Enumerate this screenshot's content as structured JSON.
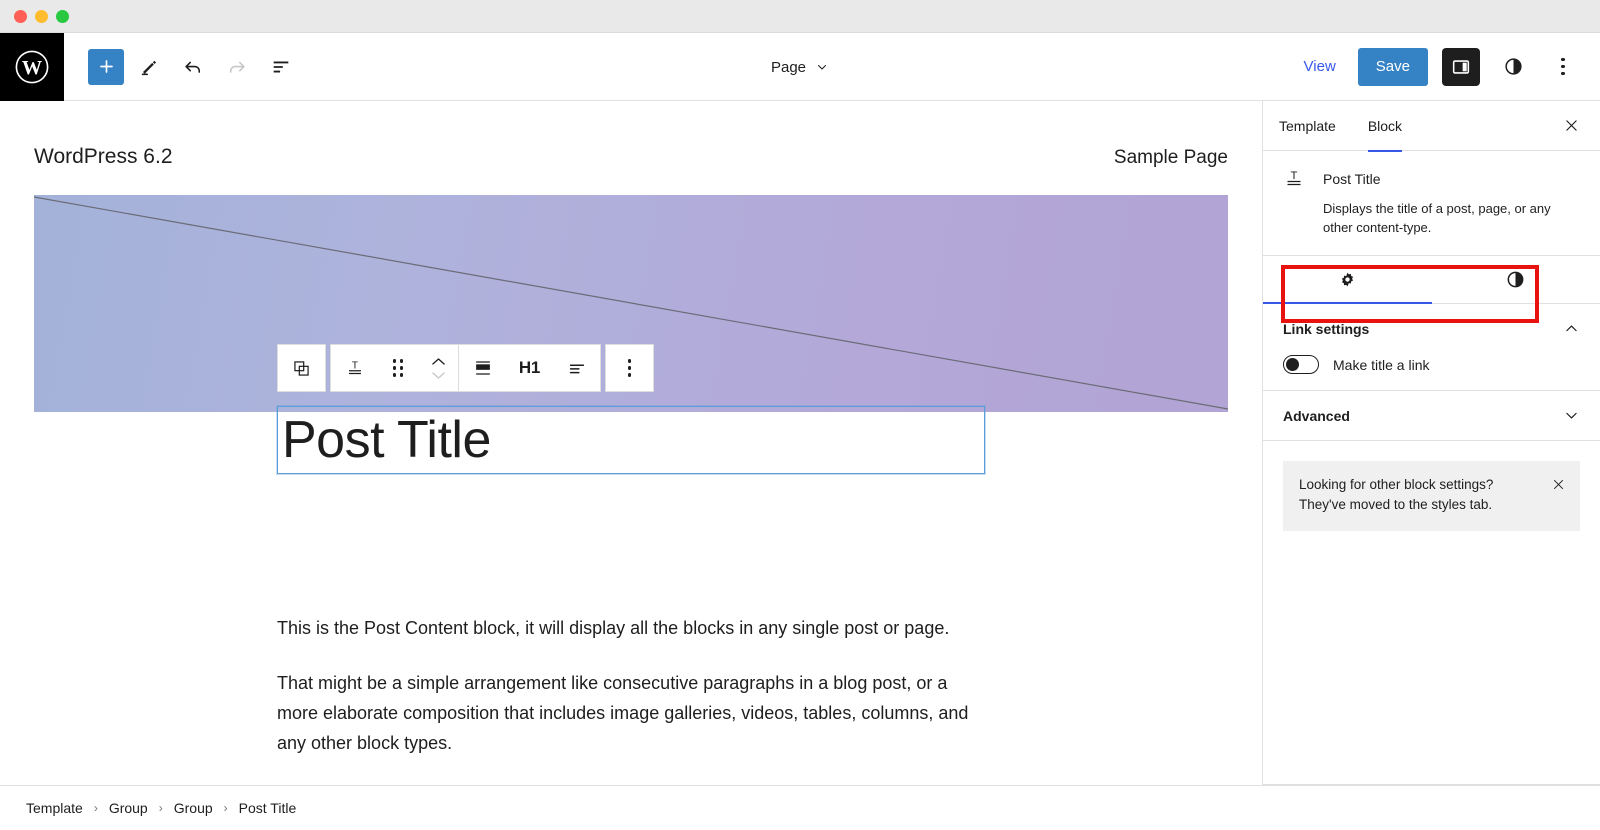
{
  "window": {
    "traffic_lights": [
      "close",
      "minimize",
      "maximize"
    ]
  },
  "topbar": {
    "logo_name": "wordpress-logo",
    "tools": [
      {
        "name": "add-block-button",
        "icon": "plus-icon",
        "label": "Add block"
      },
      {
        "name": "edit-tool-button",
        "icon": "pencil-icon",
        "label": "Edit"
      },
      {
        "name": "undo-button",
        "icon": "undo-arrow-icon",
        "label": "Undo"
      },
      {
        "name": "redo-button",
        "icon": "redo-arrow-icon",
        "label": "Redo"
      },
      {
        "name": "list-view-button",
        "icon": "list-view-icon",
        "label": "Document Overview"
      }
    ],
    "document_type": "Page",
    "document_chevron": "chevron-down-icon",
    "view_label": "View",
    "save_label": "Save",
    "settings_toggle_label": "Settings",
    "styles_toggle_label": "Styles",
    "options_label": "Options"
  },
  "canvas": {
    "site_title": "WordPress 6.2",
    "site_nav_item": "Sample Page",
    "cover": {
      "gradient_from": "#a3b2d9",
      "gradient_to": "#b2a4d4"
    },
    "block_toolbar": {
      "items": [
        {
          "name": "select-parent-block-button",
          "icon": "parent-block-icon"
        },
        {
          "name": "block-type-button",
          "icon": "post-title-icon"
        },
        {
          "name": "drag-handle",
          "icon": "drag-dots-icon"
        },
        {
          "name": "move-up-down-buttons",
          "icon": "chevron-up-down-icon"
        },
        {
          "name": "align-button",
          "icon": "align-icon"
        },
        {
          "name": "heading-level-button",
          "label": "H1"
        },
        {
          "name": "text-align-button",
          "icon": "text-align-icon"
        },
        {
          "name": "block-options-button",
          "icon": "kebab-icon"
        }
      ],
      "heading_level": "H1"
    },
    "post_title": "Post Title",
    "paragraphs": [
      "This is the Post Content block, it will display all the blocks in any single post or page.",
      "That might be a simple arrangement like consecutive paragraphs in a blog post, or a more elaborate composition that includes image galleries, videos, tables, columns, and any other block types."
    ]
  },
  "sidebar": {
    "tabs": [
      {
        "label": "Template",
        "active": false
      },
      {
        "label": "Block",
        "active": true
      }
    ],
    "close_label": "Close Settings",
    "block": {
      "icon": "post-title-icon",
      "name": "Post Title",
      "description": "Displays the title of a post, page, or any other content-type."
    },
    "subtabs": [
      {
        "name": "settings-tab",
        "icon": "gear-icon",
        "active": true
      },
      {
        "name": "styles-tab",
        "icon": "contrast-icon",
        "active": false
      }
    ],
    "highlight_color": "#e8130e",
    "accent_color": "#3858e9",
    "panels": [
      {
        "title": "Link settings",
        "expanded": true,
        "chevron": "chevron-up-icon"
      },
      {
        "title": "Advanced",
        "expanded": false,
        "chevron": "chevron-down-icon"
      }
    ],
    "link_settings": {
      "toggle_label": "Make title a link",
      "toggle_on": false
    },
    "notice": {
      "text": "Looking for other block settings? They've moved to the styles tab.",
      "close_icon": "close-icon"
    }
  },
  "breadcrumb": {
    "items": [
      "Template",
      "Group",
      "Group",
      "Post Title"
    ],
    "separator": "›"
  }
}
